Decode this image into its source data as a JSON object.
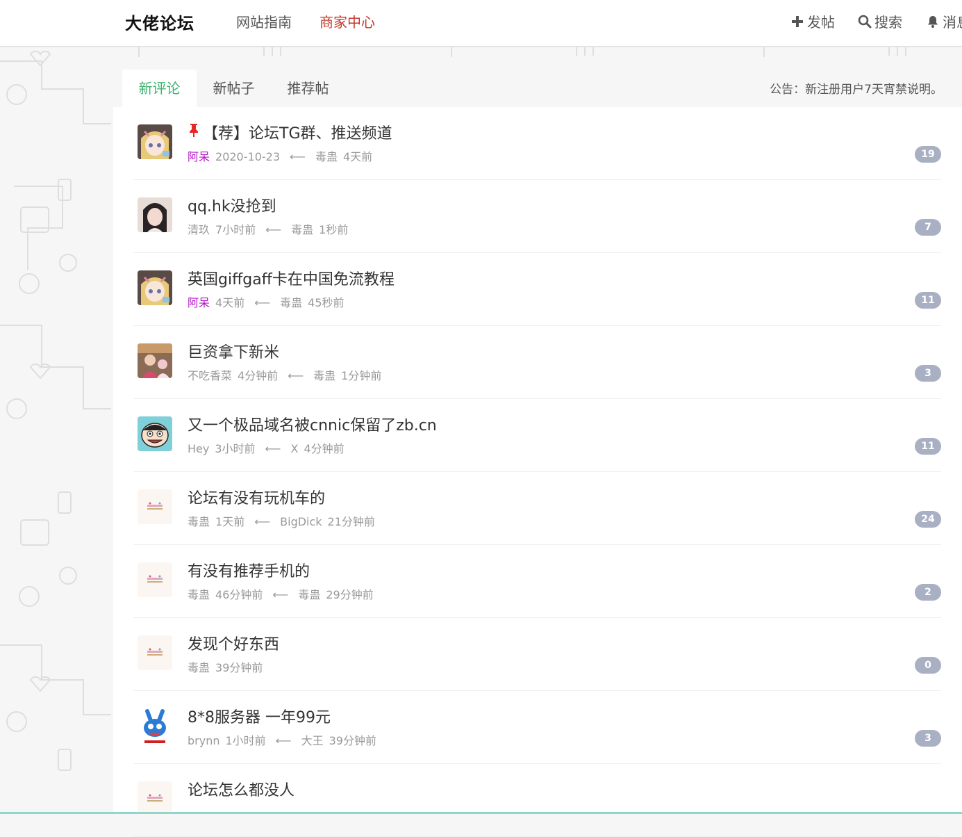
{
  "site": {
    "logo": "大佬论坛"
  },
  "topnav": {
    "links": [
      "网站指南",
      "商家中心"
    ],
    "actions": {
      "post": "发帖",
      "search": "搜索",
      "messages": "消息"
    }
  },
  "tabs": [
    "新评论",
    "新帖子",
    "推荐帖"
  ],
  "notice": "公告：新注册用户7天宵禁说明。",
  "posts": [
    {
      "title": "【荐】论坛TG群、推送频道",
      "pinned": true,
      "author": "阿呆",
      "author_vip": true,
      "time": "2020-10-23",
      "replier": "毒蛊",
      "reply_time": "4天前",
      "count": "19",
      "avatar": "anime-girl-blonde"
    },
    {
      "title": "qq.hk没抢到",
      "pinned": false,
      "author": "清玖",
      "author_vip": false,
      "time": "7小时前",
      "replier": "毒蛊",
      "reply_time": "1秒前",
      "count": "7",
      "avatar": "photo-girl-dark-hair"
    },
    {
      "title": "英国giffgaff卡在中国免流教程",
      "pinned": false,
      "author": "阿呆",
      "author_vip": true,
      "time": "4天前",
      "replier": "毒蛊",
      "reply_time": "45秒前",
      "count": "11",
      "avatar": "anime-girl-blonde"
    },
    {
      "title": "巨资拿下新米",
      "pinned": false,
      "author": "不吃香菜",
      "author_vip": false,
      "time": "4分钟前",
      "replier": "毒蛊",
      "reply_time": "1分钟前",
      "count": "3",
      "avatar": "photo-person"
    },
    {
      "title": "又一个极品域名被cnnic保留了zb.cn",
      "pinned": false,
      "author": "Hey",
      "author_vip": false,
      "time": "3小时前",
      "replier": "X",
      "reply_time": "4分钟前",
      "count": "11",
      "avatar": "cartoon-face"
    },
    {
      "title": "论坛有没有玩机车的",
      "pinned": false,
      "author": "毒蛊",
      "author_vip": false,
      "time": "1天前",
      "replier": "BigDick",
      "reply_time": "21分钟前",
      "count": "24",
      "avatar": "small-logo"
    },
    {
      "title": "有没有推荐手机的",
      "pinned": false,
      "author": "毒蛊",
      "author_vip": false,
      "time": "46分钟前",
      "replier": "毒蛊",
      "reply_time": "29分钟前",
      "count": "2",
      "avatar": "small-logo"
    },
    {
      "title": "发现个好东西",
      "pinned": false,
      "author": "毒蛊",
      "author_vip": false,
      "time": "39分钟前",
      "replier": "",
      "reply_time": "",
      "count": "0",
      "avatar": "small-logo"
    },
    {
      "title": "8*8服务器 一年99元",
      "pinned": false,
      "author": "brynn",
      "author_vip": false,
      "time": "1小时前",
      "replier": "大王",
      "reply_time": "39分钟前",
      "count": "3",
      "avatar": "blue-rabbit"
    },
    {
      "title": "论坛怎么都没人",
      "pinned": false,
      "author": "",
      "author_vip": false,
      "time": "",
      "replier": "",
      "reply_time": "",
      "count": "",
      "avatar": "small-logo"
    }
  ],
  "colors": {
    "accent_green": "#3cb371",
    "nav_active_red": "#c0392b",
    "vip_purple": "#b314c8",
    "badge_bg": "#aab0c4"
  }
}
